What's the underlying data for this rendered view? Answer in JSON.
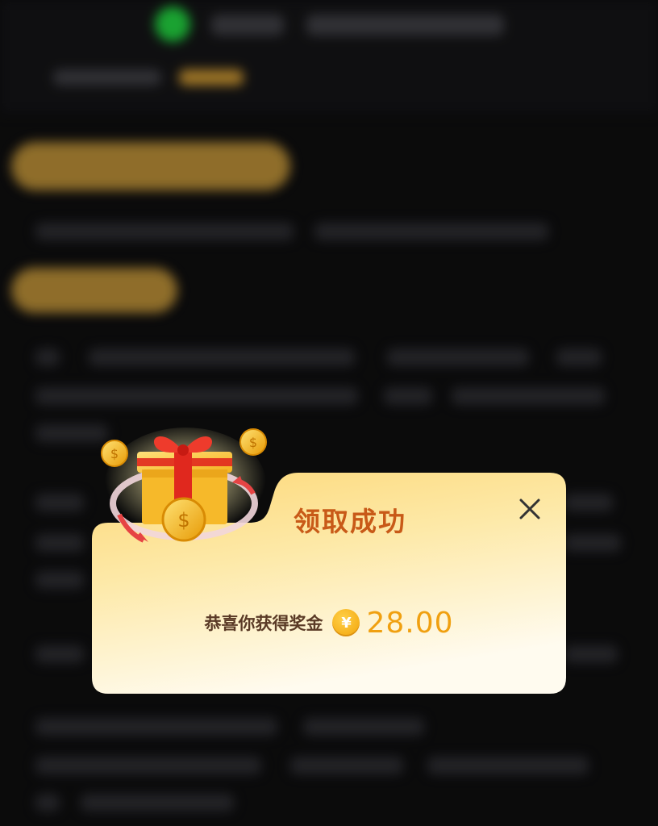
{
  "popup": {
    "title": "领取成功",
    "message": "恭喜你获得奖金",
    "currency_symbol": "¥",
    "amount": "28.00",
    "close_icon": "close-icon",
    "illustration_icon": "gift-box-with-coins-icon"
  },
  "colors": {
    "title": "#c85a18",
    "amount": "#f0a010",
    "card_top": "#fdd878",
    "card_bottom": "#fffbe8",
    "background": "#0d0d0e"
  }
}
